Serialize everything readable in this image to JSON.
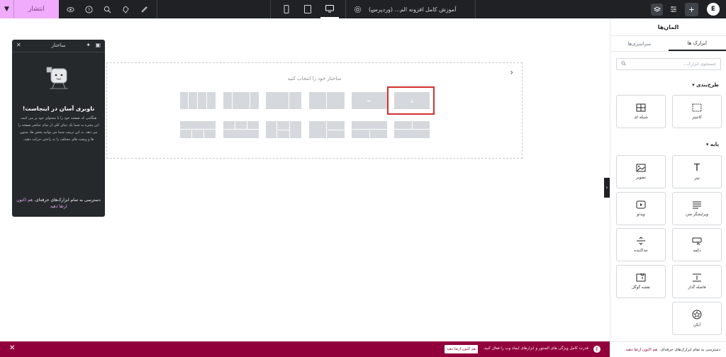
{
  "topbar": {
    "publish_label": "انتشار",
    "doc_title": "آموزش کامل افزونه الم... (وردپرس)",
    "icons": [
      "chevron-down-icon",
      "eye-icon",
      "help-icon",
      "search-icon",
      "history-icon",
      "rocket-icon",
      "gear-icon",
      "mobile-icon",
      "tablet-icon",
      "desktop-icon",
      "structure-icon",
      "sliders-icon",
      "plus-icon",
      "elementor-logo"
    ]
  },
  "canvas": {
    "dropzone_title": "ساختار خود را انتخاب کنید",
    "highlight_color": "#d32f2f"
  },
  "structure": {
    "title": "ساختار",
    "heading": "ناوبری آسان در اینجاست!",
    "description": "هنگامی که صفحه خود را با محتوای خود پر می کنید، این پنجره به شما یک نمای کلی از تمام عناصر صفحه را می دهد. به این ترتیب شما می توانید بخش ها، ستون ها و ویجت های مختلف را به راحتی حرکت دهید.",
    "promo_text": "دسترسی به تمام ابزارک‌های حرفه‌ای.",
    "promo_link": "هم اکنون ارتقا دهید"
  },
  "panel": {
    "title": "المان‌ها",
    "tabs": [
      {
        "label": "ابزارک ها"
      },
      {
        "label": "سراسری‌ها"
      }
    ],
    "search_placeholder": "جستجوی ابزارک...",
    "section_layout": "طرح‌بندی",
    "section_basic": "پایه",
    "widgets_layout": [
      {
        "label": "کانتینر",
        "icon": "container-icon"
      },
      {
        "label": "شبکه ای",
        "icon": "grid-icon"
      }
    ],
    "widgets_basic": [
      {
        "label": "تیتر",
        "icon": "heading-icon"
      },
      {
        "label": "تصویر",
        "icon": "image-icon"
      },
      {
        "label": "ویرایشگر متن",
        "icon": "text-editor-icon"
      },
      {
        "label": "ویدئو",
        "icon": "video-icon"
      },
      {
        "label": "دکمه",
        "icon": "button-icon"
      },
      {
        "label": "جداکننده",
        "icon": "divider-icon"
      },
      {
        "label": "فاصله گذار",
        "icon": "spacer-icon"
      },
      {
        "label": "نقشه گوگل",
        "icon": "map-icon"
      },
      {
        "label": "آیکن",
        "icon": "star-icon"
      }
    ],
    "bottom_text": "دسترسی به تمام ابزارک‌های حرفه‌ای.",
    "bottom_link": "هم اکنون ارتقا دهید"
  },
  "bottombar": {
    "text": "قدرت کامل ویژگی های المنتور و ابزارهای ایجاد وب را فعال کنید.",
    "button_label": "هم اکنون ارتقا دهید",
    "accent": "#92003b"
  }
}
